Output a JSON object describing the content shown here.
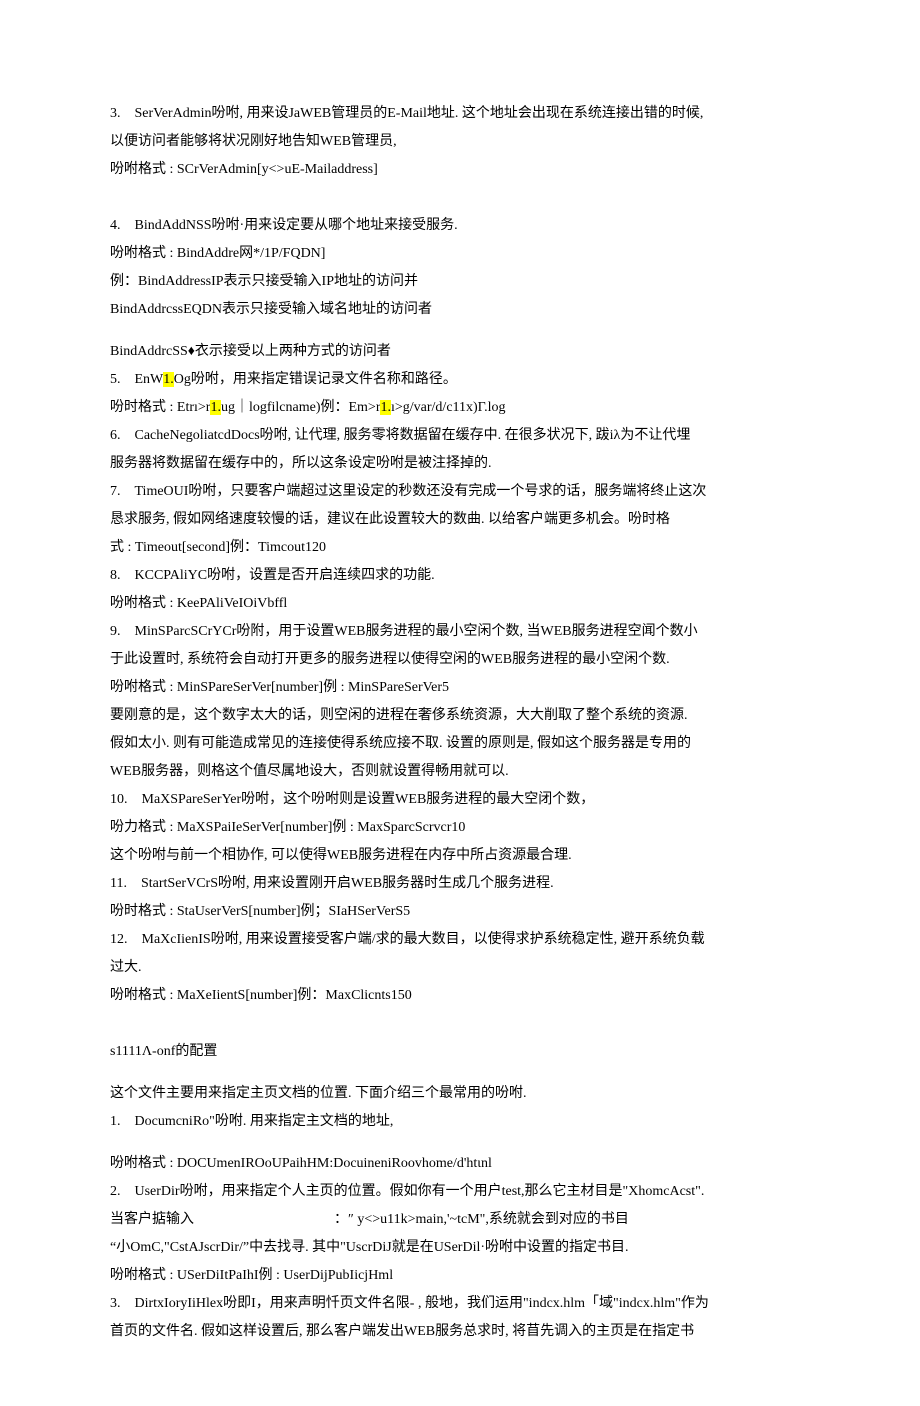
{
  "lines": [
    {
      "bind": "l0",
      "text": "3.　SerVerAdmin吩咐, 用来设JaWEB管理员的E-Mail地址. 这个地址会出现在系统连接出错的时候,"
    },
    {
      "bind": "l1",
      "text": "以便访问者能够将状况刚好地告知WEB管理员,"
    },
    {
      "bind": "l2",
      "text": "吩咐格式 : SCrVerAdmin[y<>uE-Mailaddress]"
    },
    {
      "bind": "sp",
      "text": "",
      "spacer": true
    },
    {
      "bind": "l3",
      "text": "4.　BindAddNSS吩咐·用来设定要从哪个地址来接受服务."
    },
    {
      "bind": "l4",
      "text": "吩咐格式 : BindAddre网*/1P/FQDN]"
    },
    {
      "bind": "l5",
      "text": "例：BindAddressIP表示只接受输入IP地址的访问并"
    },
    {
      "bind": "l6",
      "text": "BindAddrcssEQDN表示只接受输入域名地址的访问者"
    },
    {
      "bind": "spA",
      "text": "",
      "spacer_half": true
    },
    {
      "bind": "l7",
      "text": "BindAddrcSS♦衣示接受以上两种方式的访问者"
    },
    {
      "bind": "sp2",
      "text": "",
      "marker": "l8"
    },
    {
      "bind": "sp3",
      "text": "",
      "marker": "l9"
    },
    {
      "bind": "l10",
      "text": "6.　CacheNegoliatcdDocs吩咐, 让代理, 服务零将数据留在缓存中. 在很多状况下, 跋iλ为不让代埋"
    },
    {
      "bind": "l11",
      "text": "服务器将数据留在缓存中的，所以这条设定吩咐是被注择掉的."
    },
    {
      "bind": "l12",
      "text": "7.　TimeOUI吩咐，只要客户端超过这里设定的秒数还没有完成一个号求的话，服务端将终止这次"
    },
    {
      "bind": "l13",
      "text": "恳求服务, 假如网络速度较慢的话，建议在此设置较大的数曲. 以给客户端更多机会。吩时格"
    },
    {
      "bind": "l14",
      "text": "式 : Timeout[second]例：Timcout120"
    },
    {
      "bind": "l15",
      "text": "8.　KCCPAliYC吩咐，设置是否开启连续四求的功能."
    },
    {
      "bind": "l16",
      "text": "吩咐格式 : KeePAliVeIOiVbffl"
    },
    {
      "bind": "l17",
      "text": "9.　MinSParcSCrYCr吩附，用于设置WEB服务进程的最小空闲个数, 当WEB服务进程空闻个数小"
    },
    {
      "bind": "l18",
      "text": "于此设置时, 系统符会自动打开更多的服务进程以使得空闲的WEB服务进程的最小空闲个数."
    },
    {
      "bind": "l19",
      "text": "吩咐格式 : MinSPareSerVer[number]例 : MinSPareSerVer5"
    },
    {
      "bind": "l20",
      "text": "要刚意的是，这个数字太大的话，则空闲的进程在奢侈系统资源，大大削取了整个系统的资源."
    },
    {
      "bind": "l21",
      "text": "假如太小. 则有可能造成常见的连接使得系统应接不取. 设置的原则是, 假如这个服务器是专用的"
    },
    {
      "bind": "l22",
      "text": "WEB服务器，则格这个值尽属地设大，否则就设置得畅用就可以."
    },
    {
      "bind": "l23",
      "text": "10.　MaXSPareSerYer吩咐，这个吩咐则是设置WEB服务进程的最大空闭个数，"
    },
    {
      "bind": "l24",
      "text": "吩力格式 : MaXSPaiIeSerVer[number]例 : MaxSparcScrvcr10"
    },
    {
      "bind": "l25",
      "text": "这个吩咐与前一个相协作, 可以使得WEB服务进程在内存中所占资源最合理."
    },
    {
      "bind": "l26",
      "text": "11.　StartSerVCrS吩咐, 用来设置刚开启WEB服务器时生成几个服务进程."
    },
    {
      "bind": "l27",
      "text": "吩时格式 : StaUserVerS[number]例；SIaHSerVerS5"
    },
    {
      "bind": "l28",
      "text": "12.　MaXcIienIS吩咐, 用来设置接受客户端/求的最大数目，以使得求护系统稳定性, 避开系统负载"
    },
    {
      "bind": "l29",
      "text": "过大."
    },
    {
      "bind": "l30",
      "text": "吩咐格式 : MaXeIientS[number]例：MaxClicnts150"
    },
    {
      "bind": "spB",
      "text": "",
      "spacer": true
    },
    {
      "bind": "l31",
      "text": "s1111Λ-onf的配置"
    },
    {
      "bind": "spC",
      "text": "",
      "spacer_half": true
    },
    {
      "bind": "l32",
      "text": "这个文件主要用来指定主页文档的位置. 下面介绍三个最常用的吩咐."
    },
    {
      "bind": "l33",
      "text": "1.　DocumcniRo\"吩咐. 用来指定主文档的地址,"
    },
    {
      "bind": "spD",
      "text": "",
      "spacer_half": true
    },
    {
      "bind": "l34",
      "text": "吩咐格式 : DOCUmenIROoUPaihHM:DocuineniRoovhome/d'htιnl"
    },
    {
      "bind": "l35",
      "text": "2.　UserDir吩咐，用来指定个人主页的位置。假如你有一个用户test,那么它主材目是\"XhomcAcst\"."
    },
    {
      "bind": "l36",
      "text": "当客户掂输入　　　　　　　　　　：″ y<>u11k>main,'~tcM\",系统就会到对应的书目"
    },
    {
      "bind": "l37",
      "text": "“小OmC,\"CstAJscrDir/”中去找寻. 其中\"UscrDiJ就是在USerDil·吩咐中设置的指定书目."
    },
    {
      "bind": "l38",
      "text": "吩咐格式 : USerDiItPaIhI例 : UserDijPubIicjHml"
    },
    {
      "bind": "l39",
      "text": "3.　DirtxIoryIiHlex吩即I，用来声明忏页文件名限- , 般地，我们运用\"indcx.hlm「域\"indcx.hlm\"作为"
    },
    {
      "bind": "l40",
      "text": "首页的文件名. 假如这样设置后, 那么客户端发出WEB服务总求时, 将苜先调入的主页是在指定书"
    }
  ],
  "line8": {
    "pre": "5.　EnW",
    "hl": "1.",
    "post": "Og吩咐，用来指定错误记录文件名称和路径。"
  },
  "line9": {
    "p1": "吩时格式 : Etrı>r",
    "h1": "1.",
    "p2": "ug｜logfilcname)例：Em>r",
    "h2": "1.",
    "p3": "ı>g/var/d/c11x)Γ.log"
  }
}
